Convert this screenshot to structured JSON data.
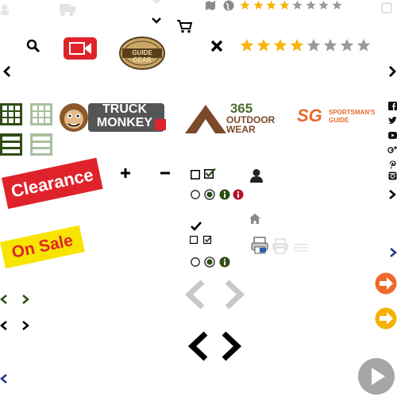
{
  "brands": {
    "guide_gear": {
      "line1": "GUIDE GEAR"
    },
    "truck_monkey": {
      "line1": "TRUCK",
      "line2": "MONKEY"
    },
    "outdoor_wear": {
      "line1": "365",
      "line2": "OUTDOOR",
      "line3": "WEAR"
    },
    "sportsmans_guide": {
      "mark": "SG",
      "line1": "SPORTSMAN'S",
      "line2": "GUIDE"
    }
  },
  "badges": {
    "clearance": "Clearance",
    "on_sale": "On Sale"
  },
  "ratings": {
    "top_rating": 4,
    "main_rating": 4,
    "max": 8
  },
  "colors": {
    "accent_red": "#e0232b",
    "sale_yellow": "#f7e400",
    "star_gold": "#f5b50a",
    "star_grey": "#9a9a9a",
    "grid_green": "#2f4d16",
    "grid_light": "#a9bfa0",
    "circle_orange": "#f0682a",
    "circle_yellow": "#f5b000",
    "outdoor_brown": "#7a4a2a",
    "sg_orange": "#e9692c",
    "play_grey": "#a6a6a6"
  },
  "icons": [
    "truck-icon",
    "chevron-down-icon",
    "map-icon",
    "globe-icon",
    "cart-icon",
    "search-icon",
    "video-icon",
    "close-icon",
    "chevron-left-icon",
    "chevron-right-icon",
    "grid-view-icon",
    "list-view-icon",
    "plus-icon",
    "minus-icon",
    "checkbox-icon",
    "user-icon",
    "radio-icon",
    "info-icon",
    "home-icon",
    "print-icon",
    "facebook-icon",
    "twitter-icon",
    "youtube-icon",
    "google-plus-icon",
    "pinterest-icon",
    "instagram-icon",
    "arrow-circle-right-icon",
    "play-icon",
    "checkmark-icon"
  ]
}
